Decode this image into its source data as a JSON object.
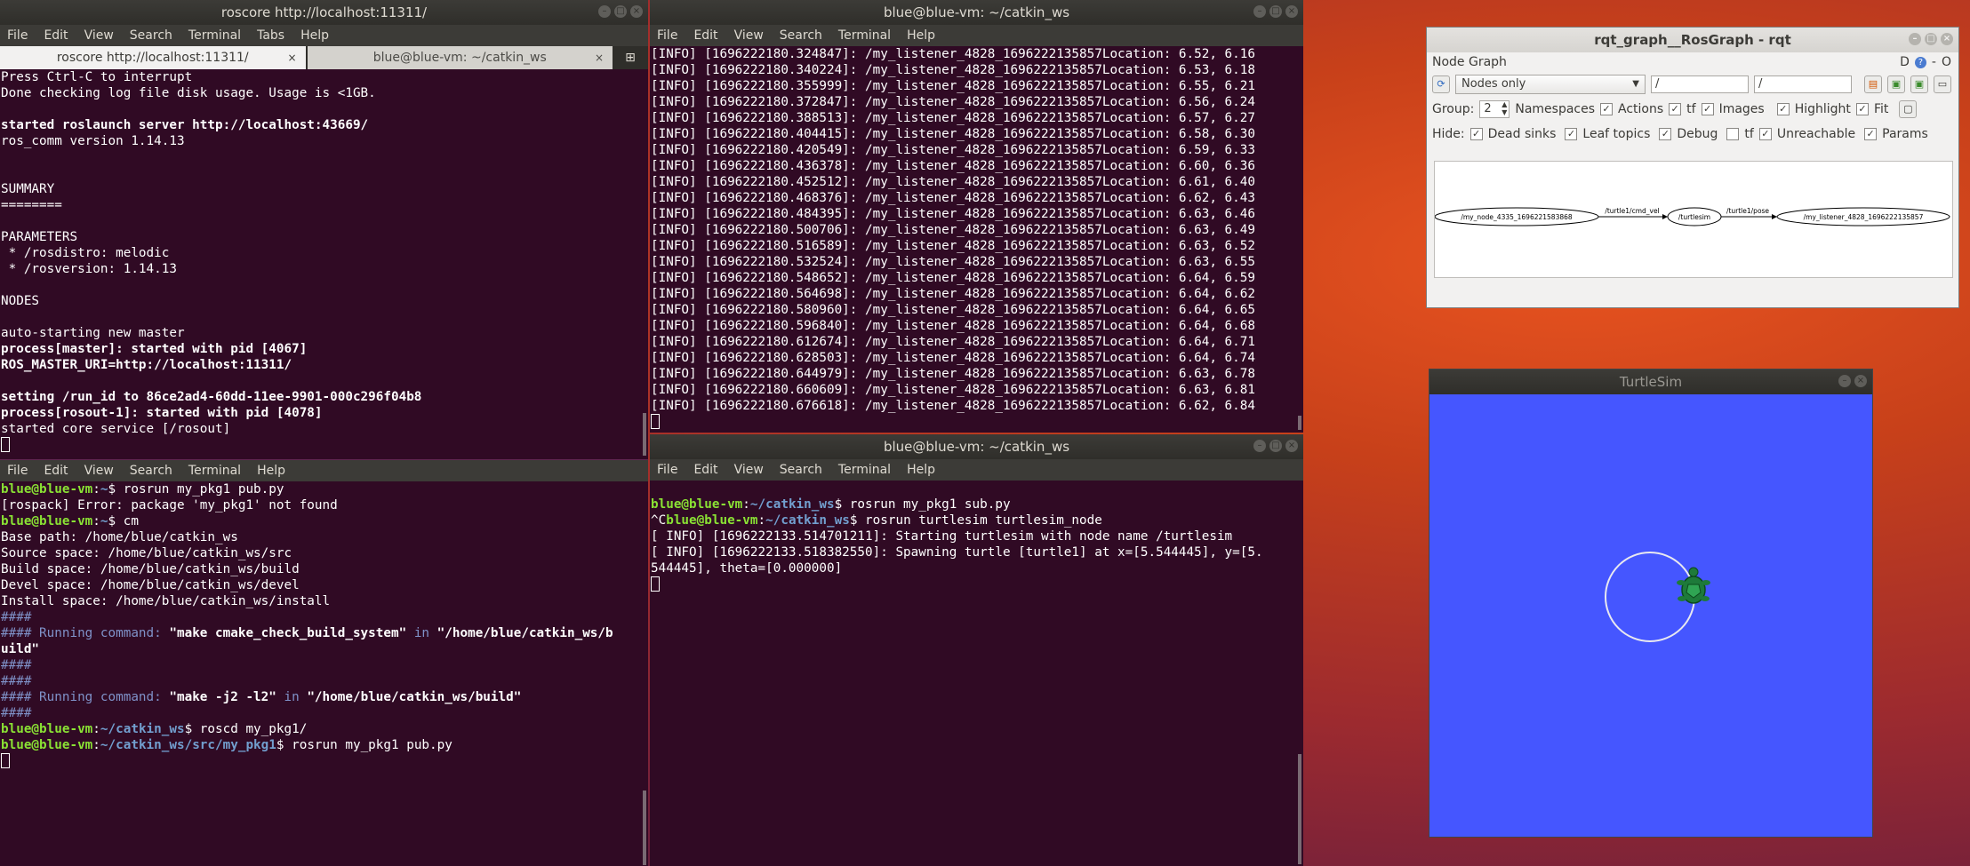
{
  "colors": {
    "terminal_bg": "#300a24",
    "prompt_green": "#8ae234",
    "path_blue": "#729fcf",
    "turtle_bg": "#4556ff"
  },
  "win1": {
    "title": "roscore http://localhost:11311/",
    "menu": [
      "File",
      "Edit",
      "View",
      "Search",
      "Terminal",
      "Tabs",
      "Help"
    ],
    "tabs": [
      "roscore http://localhost:11311/",
      "blue@blue-vm: ~/catkin_ws"
    ],
    "lines": [
      "Press Ctrl-C to interrupt",
      "Done checking log file disk usage. Usage is <1GB.",
      "",
      "started roslaunch server http://localhost:43669/",
      "ros_comm version 1.14.13",
      "",
      "",
      "SUMMARY",
      "========",
      "",
      "PARAMETERS",
      " * /rosdistro: melodic",
      " * /rosversion: 1.14.13",
      "",
      "NODES",
      "",
      "auto-starting new master",
      "process[master]: started with pid [4067]",
      "ROS_MASTER_URI=http://localhost:11311/",
      "",
      "setting /run_id to 86ce2ad4-60dd-11ee-9901-000c296f04b8",
      "process[rosout-1]: started with pid [4078]",
      "started core service [/rosout]"
    ]
  },
  "win2": {
    "menu": [
      "File",
      "Edit",
      "View",
      "Search",
      "Terminal",
      "Help"
    ],
    "lines": [
      {
        "user": "blue@blue-vm",
        "path": "~",
        "cmd": "$ rosrun my_pkg1 pub.py"
      },
      {
        "text": "[rospack] Error: package 'my_pkg1' not found"
      },
      {
        "user": "blue@blue-vm",
        "path": "~",
        "cmd": "$ cm"
      },
      {
        "text": "Base path: /home/blue/catkin_ws"
      },
      {
        "text": "Source space: /home/blue/catkin_ws/src"
      },
      {
        "text": "Build space: /home/blue/catkin_ws/build"
      },
      {
        "text": "Devel space: /home/blue/catkin_ws/devel"
      },
      {
        "text": "Install space: /home/blue/catkin_ws/install"
      },
      {
        "hash": "####"
      },
      {
        "run_a": "#### Running command: ",
        "run_b": "\"make cmake_check_build_system\"",
        "run_c": " in ",
        "run_d": "\"/home/blue/catkin_ws/b"
      },
      {
        "run_d": "uild\""
      },
      {
        "hash": "####"
      },
      {
        "hash": "####"
      },
      {
        "run_a": "#### Running command: ",
        "run_b": "\"make -j2 -l2\"",
        "run_c": " in ",
        "run_d": "\"/home/blue/catkin_ws/build\""
      },
      {
        "hash": "####"
      },
      {
        "user": "blue@blue-vm",
        "path": "~/catkin_ws",
        "cmd": "$ roscd my_pkg1/"
      },
      {
        "user": "blue@blue-vm",
        "path": "~/catkin_ws/src/my_pkg1",
        "cmd": "$ rosrun my_pkg1 pub.py"
      }
    ]
  },
  "win3": {
    "title": "blue@blue-vm: ~/catkin_ws",
    "menu": [
      "File",
      "Edit",
      "View",
      "Search",
      "Terminal",
      "Help"
    ],
    "lines": [
      "[INFO] [1696222180.324847]: /my_listener_4828_1696222135857Location: 6.52, 6.16",
      "[INFO] [1696222180.340224]: /my_listener_4828_1696222135857Location: 6.53, 6.18",
      "[INFO] [1696222180.355999]: /my_listener_4828_1696222135857Location: 6.55, 6.21",
      "[INFO] [1696222180.372847]: /my_listener_4828_1696222135857Location: 6.56, 6.24",
      "[INFO] [1696222180.388513]: /my_listener_4828_1696222135857Location: 6.57, 6.27",
      "[INFO] [1696222180.404415]: /my_listener_4828_1696222135857Location: 6.58, 6.30",
      "[INFO] [1696222180.420549]: /my_listener_4828_1696222135857Location: 6.59, 6.33",
      "[INFO] [1696222180.436378]: /my_listener_4828_1696222135857Location: 6.60, 6.36",
      "[INFO] [1696222180.452512]: /my_listener_4828_1696222135857Location: 6.61, 6.40",
      "[INFO] [1696222180.468376]: /my_listener_4828_1696222135857Location: 6.62, 6.43",
      "[INFO] [1696222180.484395]: /my_listener_4828_1696222135857Location: 6.63, 6.46",
      "[INFO] [1696222180.500706]: /my_listener_4828_1696222135857Location: 6.63, 6.49",
      "[INFO] [1696222180.516589]: /my_listener_4828_1696222135857Location: 6.63, 6.52",
      "[INFO] [1696222180.532524]: /my_listener_4828_1696222135857Location: 6.63, 6.55",
      "[INFO] [1696222180.548652]: /my_listener_4828_1696222135857Location: 6.64, 6.59",
      "[INFO] [1696222180.564698]: /my_listener_4828_1696222135857Location: 6.64, 6.62",
      "[INFO] [1696222180.580960]: /my_listener_4828_1696222135857Location: 6.64, 6.65",
      "[INFO] [1696222180.596840]: /my_listener_4828_1696222135857Location: 6.64, 6.68",
      "[INFO] [1696222180.612674]: /my_listener_4828_1696222135857Location: 6.64, 6.71",
      "[INFO] [1696222180.628503]: /my_listener_4828_1696222135857Location: 6.64, 6.74",
      "[INFO] [1696222180.644979]: /my_listener_4828_1696222135857Location: 6.63, 6.78",
      "[INFO] [1696222180.660609]: /my_listener_4828_1696222135857Location: 6.63, 6.81",
      "[INFO] [1696222180.676618]: /my_listener_4828_1696222135857Location: 6.62, 6.84"
    ]
  },
  "win4": {
    "title": "blue@blue-vm: ~/catkin_ws",
    "menu": [
      "File",
      "Edit",
      "View",
      "Search",
      "Terminal",
      "Help"
    ],
    "l1_user": "blue@blue-vm",
    "l1_path": "~/catkin_ws",
    "l1_cmd": "$ rosrun my_pkg1 sub.py",
    "l2_pre": "^C",
    "l2_user": "blue@blue-vm",
    "l2_path": "~/catkin_ws",
    "l2_cmd": "$ rosrun turtlesim turtlesim_node",
    "l3": "[ INFO] [1696222133.514701211]: Starting turtlesim with node name /turtlesim",
    "l4": "[ INFO] [1696222133.518382550]: Spawning turtle [turtle1] at x=[5.544445], y=[5.",
    "l5": "544445], theta=[0.000000]"
  },
  "rqt": {
    "title": "rqt_graph__RosGraph - rqt",
    "panel_title": "Node Graph",
    "panel_controls": "D",
    "mode": "Nodes only",
    "filter1": "/",
    "filter2": "/",
    "group_label": "Group:",
    "group_value": "2",
    "opts": [
      "Namespaces",
      "Actions",
      "tf",
      "Images",
      "Highlight",
      "Fit"
    ],
    "hide_label": "Hide:",
    "hide_opts": [
      "Dead sinks",
      "Leaf topics",
      "Debug",
      "tf",
      "Unreachable",
      "Params"
    ],
    "nodes": [
      "/my_node_4335_1696221583868",
      "/turtlesim",
      "/my_listener_4828_1696222135857"
    ],
    "edges": [
      "/turtle1/cmd_vel",
      "/turtle1/pose"
    ]
  },
  "turtle": {
    "title": "TurtleSim"
  }
}
